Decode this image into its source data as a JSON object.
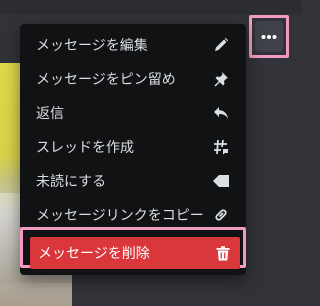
{
  "menu": {
    "items": [
      {
        "label": "メッセージを編集",
        "icon": "pencil-icon"
      },
      {
        "label": "メッセージをピン留め",
        "icon": "pin-icon"
      },
      {
        "label": "返信",
        "icon": "reply-icon"
      },
      {
        "label": "スレッドを作成",
        "icon": "thread-icon"
      },
      {
        "label": "未読にする",
        "icon": "mark-unread-icon"
      },
      {
        "label": "メッセージリンクをコピー",
        "icon": "link-icon"
      },
      {
        "label": "メッセージを削除",
        "icon": "trash-icon"
      }
    ]
  },
  "colors": {
    "menu_bg": "#111214",
    "text": "#dbdee1",
    "danger": "#da373c",
    "highlight_frame": "#f19bc2",
    "page_bg": "#313338",
    "button_bg": "#404249"
  },
  "more_button": {
    "icon": "more-horizontal-icon"
  }
}
